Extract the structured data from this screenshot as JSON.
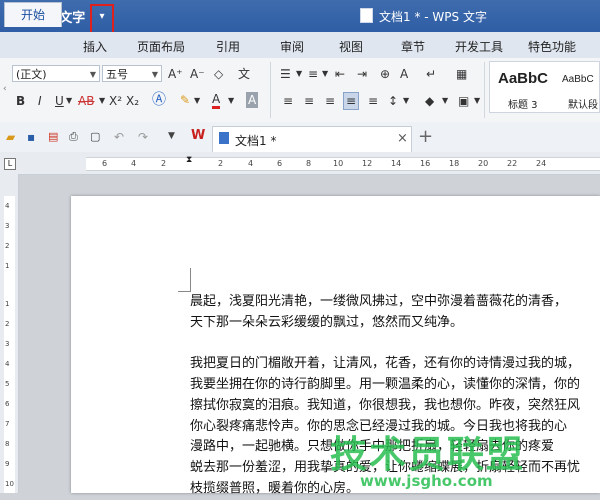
{
  "app": {
    "title": "WPS 文字",
    "logo_glyph": "W",
    "menu_arrow_glyph": "▾",
    "document_title": "文档1 * - WPS 文字"
  },
  "tabs": {
    "active": "开始",
    "items": [
      "插入",
      "页面布局",
      "引用",
      "审阅",
      "视图",
      "章节",
      "开发工具",
      "特色功能"
    ]
  },
  "ribbon": {
    "font_name": "(正文)",
    "font_size": "五号",
    "style_sample_1": "AaBbC",
    "style_sample_2": "AaBbC",
    "style_label_1": "标题 3",
    "style_label_2": "默认段",
    "font_grow": "A⁺",
    "font_shrink": "A⁻",
    "bold": "B",
    "italic": "I",
    "underline": "U",
    "strike": "AB",
    "superscript": "X²",
    "subscript": "X₂",
    "font_color": "A",
    "highlight_label": "A"
  },
  "doc_tab": {
    "label": "文档1 *",
    "close": "×",
    "new": "+"
  },
  "ruler": {
    "h_ticks": [
      "6",
      "4",
      "2",
      "2",
      "4",
      "6",
      "8",
      "10",
      "12",
      "14",
      "16",
      "18",
      "20",
      "22",
      "24"
    ],
    "v_ticks": [
      "4",
      "3",
      "2",
      "1",
      "1",
      "2",
      "3",
      "4",
      "5",
      "6",
      "7",
      "8",
      "9",
      "10"
    ]
  },
  "document": {
    "lines": [
      "晨起，浅夏阳光清艳，一缕微风拂过，空中弥漫着蔷薇花的清香，",
      "天下那一朵朵云彩缓缓的飘过，悠然而又纯净。",
      "",
      "我把夏日的门楣敞开着，让清风，花香，还有你的诗情漫过我的城，",
      "我要坐拥在你的诗行韵脚里。用一颗温柔的心，读懂你的深情，你的",
      "擦拭你寂寞的泪痕。我知道，你很想我，我也想你。昨夜，突然狂风",
      "你心裂疼痛悲怜声。你的思念已经漫过我的城。今日我也将我的心",
      "漫路中，一起驰横。只想做你手中那把折扇，轻轻扇去你的疼爱",
      "蜕去那一份羞涩，用我挚真的爱，让你蜷缩蝶展，折扇轻轻而不再忧",
      "枝揽缀普照，暖着你的心房。"
    ]
  },
  "watermark": {
    "text": "技术员联盟",
    "url": "www.jsgho.com"
  },
  "colors": {
    "titlebar": "#2f5ea6",
    "highlight_box": "#e0201d",
    "active_tab_text": "#1a4fa0",
    "watermark": "#28be50"
  }
}
